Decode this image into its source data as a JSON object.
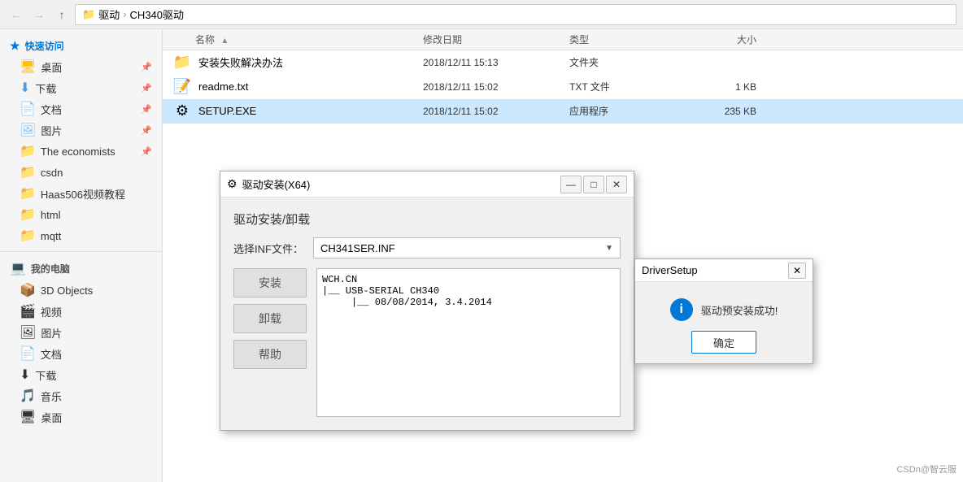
{
  "titlebar": {
    "breadcrumb": [
      "驱动",
      "CH340驱动"
    ]
  },
  "sidebar": {
    "quickaccess_label": "快速访问",
    "items": [
      {
        "id": "desktop",
        "label": "桌面",
        "icon": "📁",
        "pinned": true
      },
      {
        "id": "downloads",
        "label": "下载",
        "icon": "⬇",
        "pinned": true
      },
      {
        "id": "docs",
        "label": "文档",
        "icon": "📄",
        "pinned": true
      },
      {
        "id": "pics",
        "label": "图片",
        "icon": "📁",
        "pinned": true
      },
      {
        "id": "economists",
        "label": "The economists",
        "icon": "📁",
        "pinned": true
      },
      {
        "id": "csdn",
        "label": "csdn",
        "icon": "📁",
        "pinned": false
      },
      {
        "id": "haas",
        "label": "Haas506视频教程",
        "icon": "📁",
        "pinned": false
      },
      {
        "id": "html",
        "label": "html",
        "icon": "📁",
        "pinned": false
      },
      {
        "id": "mqtt",
        "label": "mqtt",
        "icon": "📁",
        "pinned": false
      }
    ],
    "mypc_label": "我的电脑",
    "pc_items": [
      {
        "id": "3dobjects",
        "label": "3D Objects",
        "icon": "📦"
      },
      {
        "id": "videos",
        "label": "视频",
        "icon": "🎬"
      },
      {
        "id": "pictures",
        "label": "图片",
        "icon": "🖼"
      },
      {
        "id": "documents",
        "label": "文档",
        "icon": "📄"
      },
      {
        "id": "dl2",
        "label": "下载",
        "icon": "⬇"
      },
      {
        "id": "music",
        "label": "音乐",
        "icon": "🎵"
      },
      {
        "id": "desktop2",
        "label": "桌面",
        "icon": "🖥"
      }
    ]
  },
  "filelist": {
    "columns": {
      "name": "名称",
      "date": "修改日期",
      "type": "类型",
      "size": "大小"
    },
    "files": [
      {
        "name": "安装失败解决办法",
        "icon": "📁",
        "date": "2018/12/11 15:13",
        "type": "文件夹",
        "size": "",
        "selected": false
      },
      {
        "name": "readme.txt",
        "icon": "📝",
        "date": "2018/12/11 15:02",
        "type": "TXT 文件",
        "size": "1 KB",
        "selected": false
      },
      {
        "name": "SETUP.EXE",
        "icon": "⚙",
        "date": "2018/12/11 15:02",
        "type": "应用程序",
        "size": "235 KB",
        "selected": true
      }
    ]
  },
  "driver_dialog": {
    "title": "驱动安装(X64)",
    "section_title": "驱动安装/卸载",
    "inf_label": "选择INF文件：",
    "inf_value": "CH341SER.INF",
    "btn_install": "安装",
    "btn_uninstall": "卸载",
    "btn_help": "帮助",
    "log_text": "WCH.CN\n|__ USB-SERIAL CH340\n     |__ 08/08/2014, 3.4.2014"
  },
  "success_dialog": {
    "title": "DriverSetup",
    "message": "驱动预安装成功!",
    "ok_label": "确定"
  },
  "watermark": "CSDn@智云服"
}
